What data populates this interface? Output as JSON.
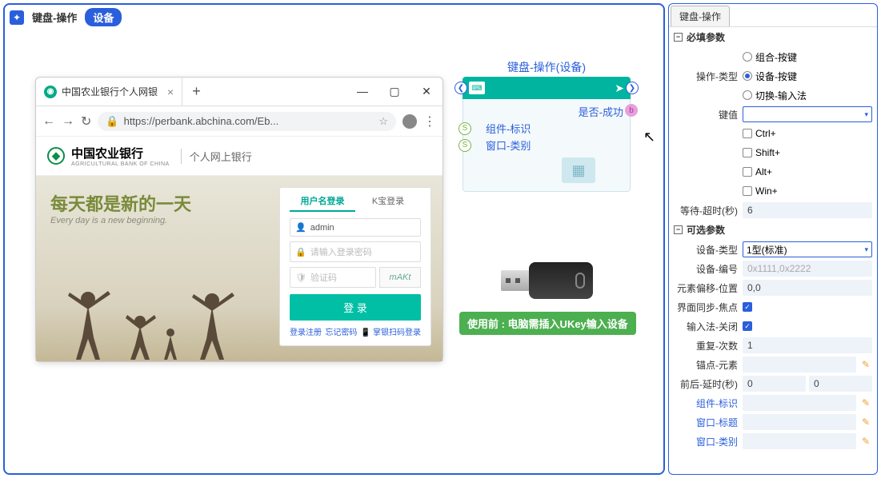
{
  "tabs": {
    "keyboardOp": "键盘-操作",
    "device": "设备"
  },
  "browser": {
    "tabTitle": "中国农业银行个人网银",
    "url": "https://perbank.abchina.com/Eb...",
    "bankNameCn": "中国农业银行",
    "bankNameEn": "AGRICULTURAL BANK OF CHINA",
    "bankSub": "个人网上银行"
  },
  "hero": {
    "cn": "每天都是新的一天",
    "en": "Every day is a new beginning."
  },
  "login": {
    "tab1": "用户名登录",
    "tab2": "K宝登录",
    "username": "admin",
    "pwPlaceholder": "请输入登录密码",
    "captchaPlaceholder": "验证码",
    "captchaImg": "mAKt",
    "button": "登 录",
    "link1": "登录注册",
    "link2": "忘记密码",
    "link3": "掌银扫码登录"
  },
  "node": {
    "title": "键盘-操作(设备)",
    "success": "是否-成功",
    "row1": "组件-标识",
    "row2": "窗口-类别"
  },
  "ukeyLabel": "使用前 : 电脑需插入UKey输入设备",
  "props": {
    "tab": "键盘-操作",
    "section1": "必填参数",
    "opType": {
      "label": "操作-类型",
      "opt1": "组合-按键",
      "opt2": "设备-按键",
      "opt3": "切换-输入法"
    },
    "keyValue": "键值",
    "mod": {
      "ctrl": "Ctrl+",
      "shift": "Shift+",
      "alt": "Alt+",
      "win": "Win+"
    },
    "timeout": {
      "label": "等待-超时(秒)",
      "value": "6"
    },
    "section2": "可选参数",
    "deviceType": {
      "label": "设备-类型",
      "value": "1型(标准)"
    },
    "deviceNo": {
      "label": "设备-编号",
      "placeholder": "0x1111,0x2222"
    },
    "offset": {
      "label": "元素偏移-位置",
      "value": "0,0"
    },
    "syncFocus": "界面同步-焦点",
    "imeClose": "输入法-关闭",
    "repeat": {
      "label": "重复-次数",
      "value": "1"
    },
    "anchor": "锚点-元素",
    "delay": {
      "label": "前后-延时(秒)",
      "v1": "0",
      "v2": "0"
    },
    "componentId": "组件-标识",
    "windowTitle": "窗口-标题",
    "windowClass": "窗口-类别"
  }
}
